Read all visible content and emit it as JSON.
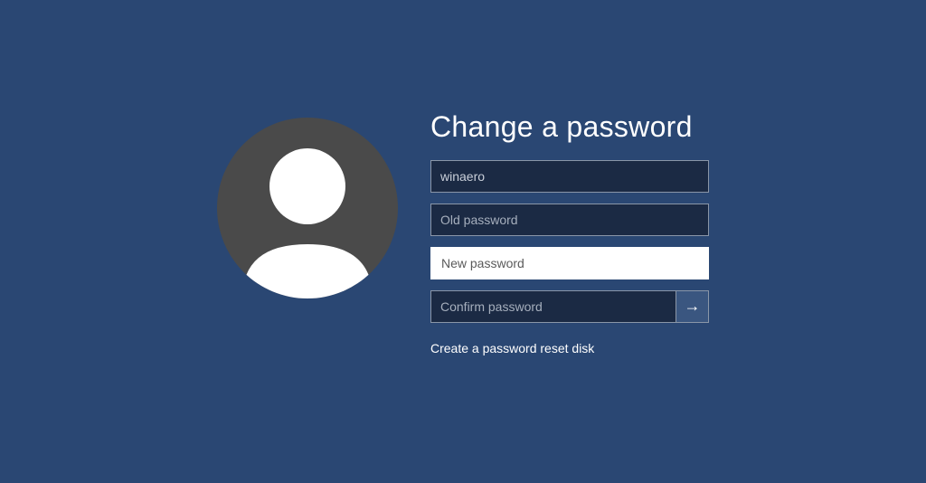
{
  "title": "Change a password",
  "username": "winaero",
  "placeholders": {
    "old_password": "Old password",
    "new_password": "New password",
    "confirm_password": "Confirm password"
  },
  "link_text": "Create a password reset disk",
  "icons": {
    "submit_arrow": "→"
  }
}
